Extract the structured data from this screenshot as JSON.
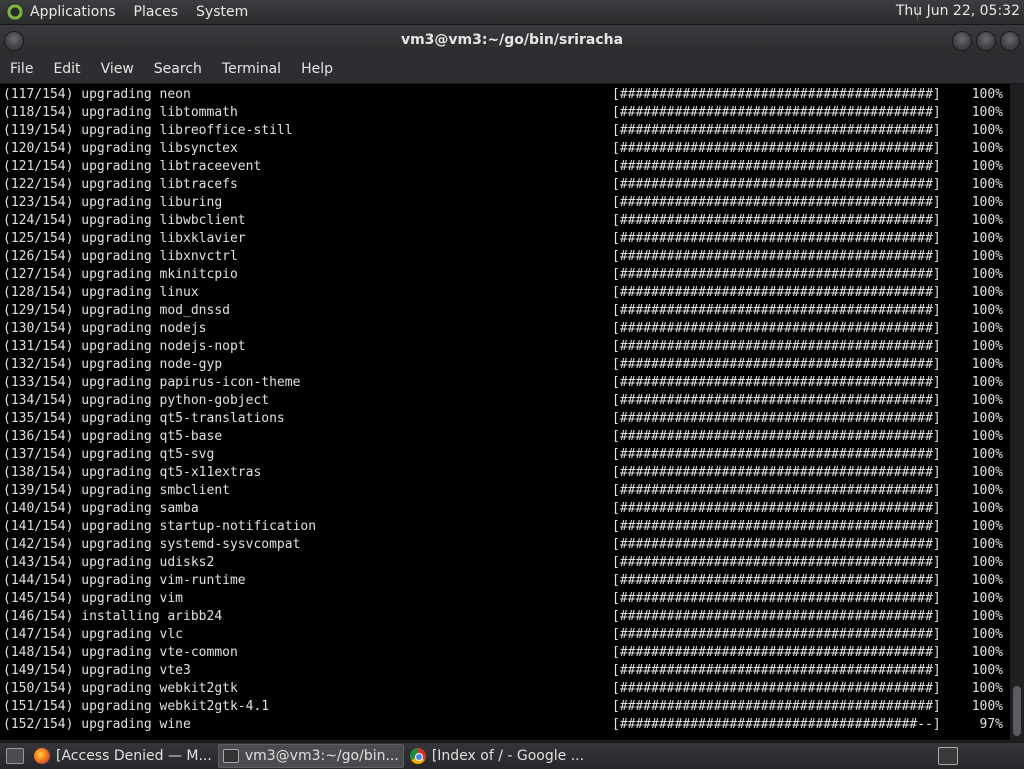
{
  "top_panel": {
    "menus": [
      "Applications",
      "Places",
      "System"
    ],
    "clock": "Thu Jun 22, 05:32"
  },
  "window": {
    "title": "vm3@vm3:~/go/bin/sriracha"
  },
  "menubar": [
    "File",
    "Edit",
    "View",
    "Search",
    "Terminal",
    "Help"
  ],
  "terminal": {
    "lines": [
      {
        "msg": "(117/154) upgrading neon",
        "bar": "[########################################]",
        "pct": "100%"
      },
      {
        "msg": "(118/154) upgrading libtommath",
        "bar": "[########################################]",
        "pct": "100%"
      },
      {
        "msg": "(119/154) upgrading libreoffice-still",
        "bar": "[########################################]",
        "pct": "100%"
      },
      {
        "msg": "(120/154) upgrading libsynctex",
        "bar": "[########################################]",
        "pct": "100%"
      },
      {
        "msg": "(121/154) upgrading libtraceevent",
        "bar": "[########################################]",
        "pct": "100%"
      },
      {
        "msg": "(122/154) upgrading libtracefs",
        "bar": "[########################################]",
        "pct": "100%"
      },
      {
        "msg": "(123/154) upgrading liburing",
        "bar": "[########################################]",
        "pct": "100%"
      },
      {
        "msg": "(124/154) upgrading libwbclient",
        "bar": "[########################################]",
        "pct": "100%"
      },
      {
        "msg": "(125/154) upgrading libxklavier",
        "bar": "[########################################]",
        "pct": "100%"
      },
      {
        "msg": "(126/154) upgrading libxnvctrl",
        "bar": "[########################################]",
        "pct": "100%"
      },
      {
        "msg": "(127/154) upgrading mkinitcpio",
        "bar": "[########################################]",
        "pct": "100%"
      },
      {
        "msg": "(128/154) upgrading linux",
        "bar": "[########################################]",
        "pct": "100%"
      },
      {
        "msg": "(129/154) upgrading mod_dnssd",
        "bar": "[########################################]",
        "pct": "100%"
      },
      {
        "msg": "(130/154) upgrading nodejs",
        "bar": "[########################################]",
        "pct": "100%"
      },
      {
        "msg": "(131/154) upgrading nodejs-nopt",
        "bar": "[########################################]",
        "pct": "100%"
      },
      {
        "msg": "(132/154) upgrading node-gyp",
        "bar": "[########################################]",
        "pct": "100%"
      },
      {
        "msg": "(133/154) upgrading papirus-icon-theme",
        "bar": "[########################################]",
        "pct": "100%"
      },
      {
        "msg": "(134/154) upgrading python-gobject",
        "bar": "[########################################]",
        "pct": "100%"
      },
      {
        "msg": "(135/154) upgrading qt5-translations",
        "bar": "[########################################]",
        "pct": "100%"
      },
      {
        "msg": "(136/154) upgrading qt5-base",
        "bar": "[########################################]",
        "pct": "100%"
      },
      {
        "msg": "(137/154) upgrading qt5-svg",
        "bar": "[########################################]",
        "pct": "100%"
      },
      {
        "msg": "(138/154) upgrading qt5-x11extras",
        "bar": "[########################################]",
        "pct": "100%"
      },
      {
        "msg": "(139/154) upgrading smbclient",
        "bar": "[########################################]",
        "pct": "100%"
      },
      {
        "msg": "(140/154) upgrading samba",
        "bar": "[########################################]",
        "pct": "100%"
      },
      {
        "msg": "(141/154) upgrading startup-notification",
        "bar": "[########################################]",
        "pct": "100%"
      },
      {
        "msg": "(142/154) upgrading systemd-sysvcompat",
        "bar": "[########################################]",
        "pct": "100%"
      },
      {
        "msg": "(143/154) upgrading udisks2",
        "bar": "[########################################]",
        "pct": "100%"
      },
      {
        "msg": "(144/154) upgrading vim-runtime",
        "bar": "[########################################]",
        "pct": "100%"
      },
      {
        "msg": "(145/154) upgrading vim",
        "bar": "[########################################]",
        "pct": "100%"
      },
      {
        "msg": "(146/154) installing aribb24",
        "bar": "[########################################]",
        "pct": "100%"
      },
      {
        "msg": "(147/154) upgrading vlc",
        "bar": "[########################################]",
        "pct": "100%"
      },
      {
        "msg": "(148/154) upgrading vte-common",
        "bar": "[########################################]",
        "pct": "100%"
      },
      {
        "msg": "(149/154) upgrading vte3",
        "bar": "[########################################]",
        "pct": "100%"
      },
      {
        "msg": "(150/154) upgrading webkit2gtk",
        "bar": "[########################################]",
        "pct": "100%"
      },
      {
        "msg": "(151/154) upgrading webkit2gtk-4.1",
        "bar": "[########################################]",
        "pct": "100%"
      },
      {
        "msg": "(152/154) upgrading wine",
        "bar": "[######################################--]",
        "pct": "97%"
      }
    ]
  },
  "taskbar": {
    "tasks": [
      {
        "label": "[Access Denied — M...",
        "icon": "firefox-icon"
      },
      {
        "label": "vm3@vm3:~/go/bin...",
        "icon": "terminal-icon"
      },
      {
        "label": "[Index of / - Google ...",
        "icon": "chrome-icon"
      }
    ]
  }
}
